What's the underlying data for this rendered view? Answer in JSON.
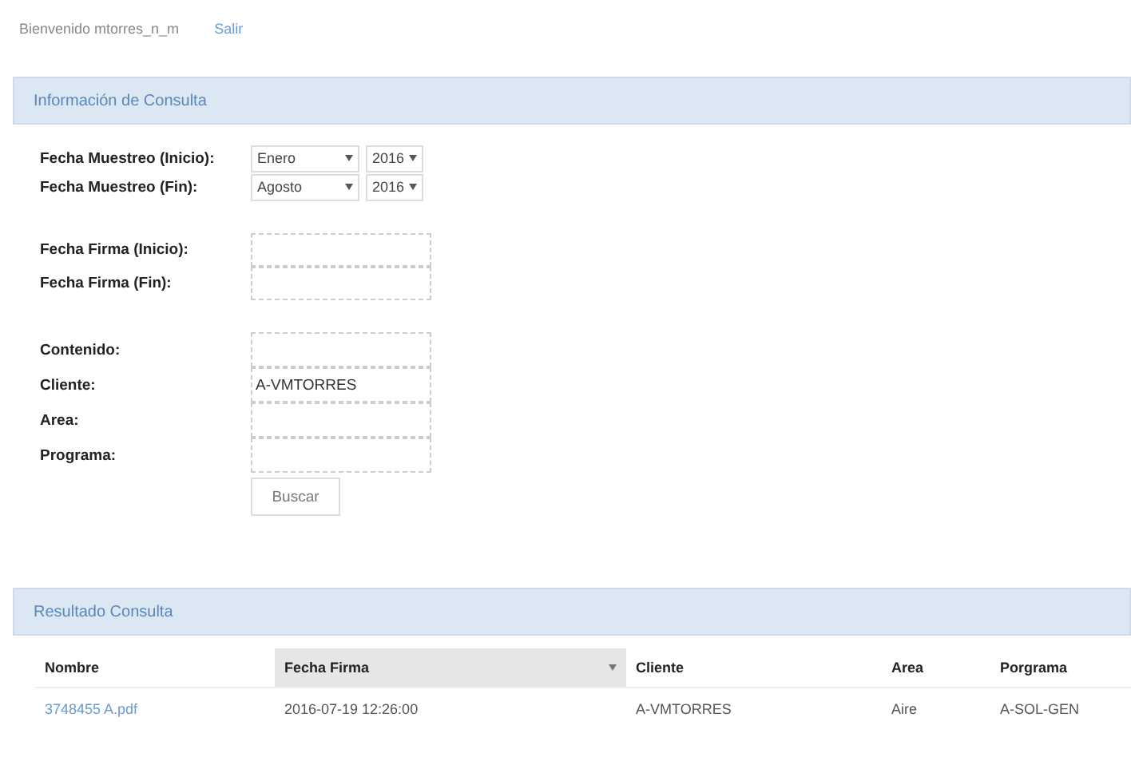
{
  "header": {
    "welcome": "Bienvenido mtorres_n_m",
    "logout": "Salir"
  },
  "query_panel": {
    "title": "Información de Consulta",
    "date_selects": [
      {
        "label": "Fecha Muestreo (Inicio):",
        "month": "Enero",
        "year": "2016"
      },
      {
        "label": "Fecha Muestreo (Fin):",
        "month": "Agosto",
        "year": "2016"
      }
    ],
    "date_fields": [
      {
        "label": "Fecha Firma (Inicio):"
      },
      {
        "label": "Fecha Firma (Fin):"
      }
    ],
    "text_fields": [
      {
        "label": "Contenido:"
      },
      {
        "label": "Cliente:",
        "value": "A-VMTORRES"
      },
      {
        "label": "Area:"
      },
      {
        "label": "Programa:"
      }
    ],
    "search_button": "Buscar"
  },
  "results_panel": {
    "title": "Resultado Consulta",
    "columns": [
      {
        "label": "Nombre",
        "sorted": false
      },
      {
        "label": "Fecha Firma",
        "sorted": true
      },
      {
        "label": "Cliente",
        "sorted": false
      },
      {
        "label": "Area",
        "sorted": false
      },
      {
        "label": "Porgrama",
        "sorted": false
      }
    ],
    "rows": [
      {
        "cells": [
          "3748455 A.pdf",
          "2016-07-19 12:26:00",
          "A-VMTORRES",
          "Aire",
          "A-SOL-GEN"
        ]
      }
    ]
  }
}
